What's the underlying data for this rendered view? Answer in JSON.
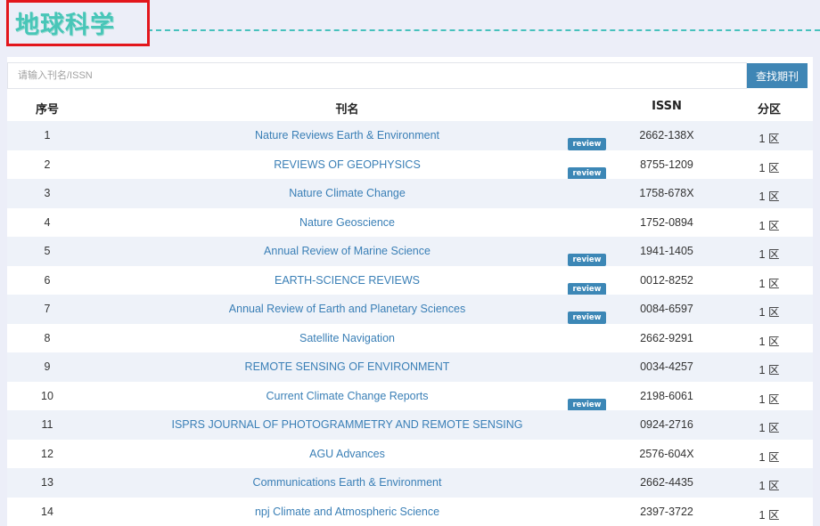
{
  "page": {
    "title": "地球科学"
  },
  "search": {
    "placeholder": "请输入刊名/ISSN",
    "button_label": "查找期刊"
  },
  "table": {
    "headers": {
      "no": "序号",
      "name": "刊名",
      "issn": "ISSN",
      "zone": "分区"
    },
    "rows": [
      {
        "no": "1",
        "name": "Nature Reviews Earth & Environment",
        "review": "review",
        "issn": "2662-138X",
        "zone": "1 区"
      },
      {
        "no": "2",
        "name": "REVIEWS OF GEOPHYSICS",
        "review": "review",
        "issn": "8755-1209",
        "zone": "1 区"
      },
      {
        "no": "3",
        "name": "Nature Climate Change",
        "review": "",
        "issn": "1758-678X",
        "zone": "1 区"
      },
      {
        "no": "4",
        "name": "Nature Geoscience",
        "review": "",
        "issn": "1752-0894",
        "zone": "1 区"
      },
      {
        "no": "5",
        "name": "Annual Review of Marine Science",
        "review": "review",
        "issn": "1941-1405",
        "zone": "1 区"
      },
      {
        "no": "6",
        "name": "EARTH-SCIENCE REVIEWS",
        "review": "review",
        "issn": "0012-8252",
        "zone": "1 区"
      },
      {
        "no": "7",
        "name": "Annual Review of Earth and Planetary Sciences",
        "review": "review",
        "issn": "0084-6597",
        "zone": "1 区"
      },
      {
        "no": "8",
        "name": "Satellite Navigation",
        "review": "",
        "issn": "2662-9291",
        "zone": "1 区"
      },
      {
        "no": "9",
        "name": "REMOTE SENSING OF ENVIRONMENT",
        "review": "",
        "issn": "0034-4257",
        "zone": "1 区"
      },
      {
        "no": "10",
        "name": "Current Climate Change Reports",
        "review": "review",
        "issn": "2198-6061",
        "zone": "1 区"
      },
      {
        "no": "11",
        "name": "ISPRS JOURNAL OF PHOTOGRAMMETRY AND REMOTE SENSING",
        "review": "",
        "issn": "0924-2716",
        "zone": "1 区"
      },
      {
        "no": "12",
        "name": "AGU Advances",
        "review": "",
        "issn": "2576-604X",
        "zone": "1 区"
      },
      {
        "no": "13",
        "name": "Communications Earth & Environment",
        "review": "",
        "issn": "2662-4435",
        "zone": "1 区"
      },
      {
        "no": "14",
        "name": "npj Climate and Atmospheric Science",
        "review": "",
        "issn": "2397-3722",
        "zone": "1 区"
      }
    ]
  },
  "colors": {
    "title": "#48c6b8",
    "highlight_box": "#e3161c",
    "accent": "#3f86b5",
    "link": "#3a7fb6",
    "stripe": "#eef2f9"
  }
}
